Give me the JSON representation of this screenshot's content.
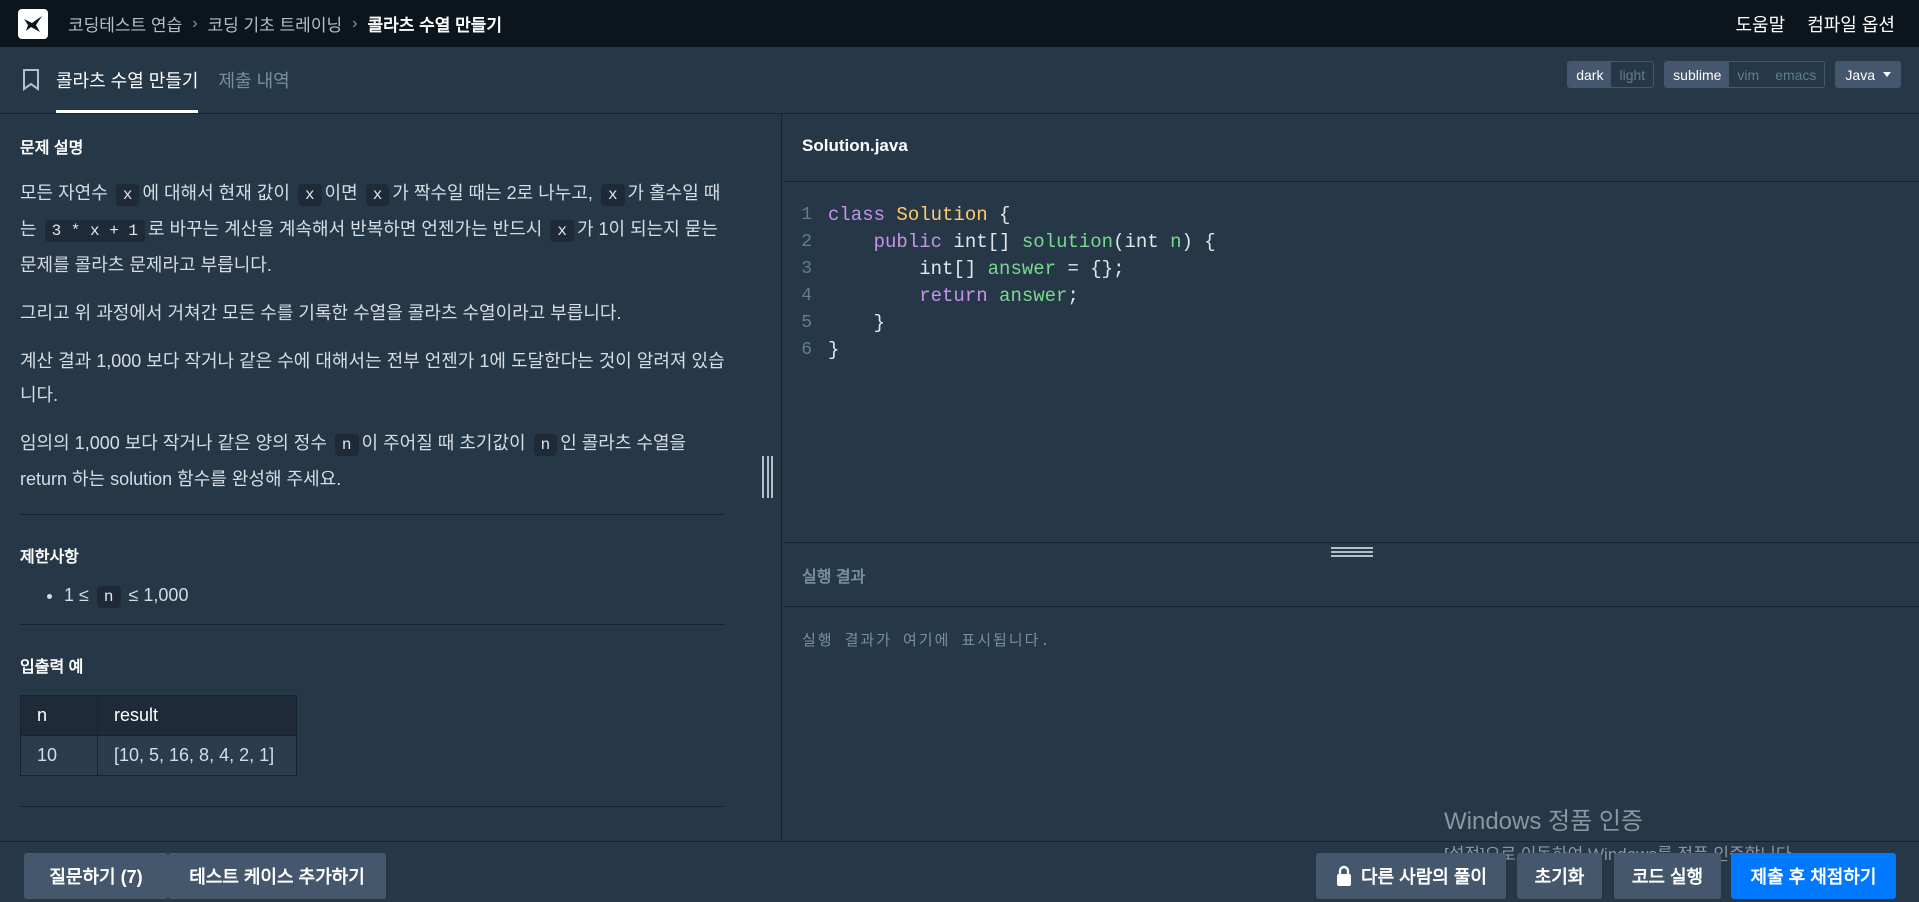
{
  "nav": {
    "breadcrumb": [
      "코딩테스트 연습",
      "코딩 기초 트레이닝",
      "콜라츠 수열 만들기"
    ],
    "help": "도움말",
    "compile_options": "컴파일 옵션"
  },
  "tabs": {
    "problem": "콜라츠 수열 만들기",
    "submissions": "제출 내역"
  },
  "editor_options": {
    "theme": [
      "dark",
      "light"
    ],
    "keymap": [
      "sublime",
      "vim",
      "emacs"
    ],
    "language": "Java"
  },
  "problem": {
    "section_description": "문제 설명",
    "p1_a": "모든 자연수",
    "p1_x1": "x",
    "p1_b": "에 대해서 현재 값이",
    "p1_x2": "x",
    "p1_c": "이면",
    "p1_x3": "x",
    "p1_d": "가 짝수일 때는 2로 나누고,",
    "p1_x4": "x",
    "p1_e": "가 홀수일 때는",
    "p1_expr": "3 * x + 1",
    "p1_f": "로 바꾸는 계산을 계속해서 반복하면 언젠가는 반드시",
    "p1_x5": "x",
    "p1_g": "가 1이 되는지 묻는 문제를 콜라츠 문제라고 부릅니다.",
    "p2": "그리고 위 과정에서 거쳐간 모든 수를 기록한 수열을 콜라츠 수열이라고 부릅니다.",
    "p3": "계산 결과 1,000 보다 작거나 같은 수에 대해서는 전부 언젠가 1에 도달한다는 것이 알려져 있습니다.",
    "p4_a": "임의의 1,000 보다 작거나 같은 양의 정수",
    "p4_n1": "n",
    "p4_b": "이 주어질 때 초기값이",
    "p4_n2": "n",
    "p4_c": "인 콜라츠 수열을 return 하는 solution 함수를 완성해 주세요.",
    "section_constraints": "제한사항",
    "constraint_a": "1 ≤",
    "constraint_n": "n",
    "constraint_b": "≤ 1,000",
    "section_examples": "입출력 예",
    "table_headers": [
      "n",
      "result"
    ],
    "table_rows": [
      [
        "10",
        "[10, 5, 16, 8, 4, 2, 1]"
      ]
    ]
  },
  "editor": {
    "filename": "Solution.java",
    "line_numbers": [
      "1",
      "2",
      "3",
      "4",
      "5",
      "6"
    ],
    "code": {
      "l1_kw": "class",
      "l1_cls": "Solution",
      "l1_rest": " {",
      "l2_kw": "public",
      "l2_type": " int[] ",
      "l2_fn": "solution",
      "l2_p1": "(int ",
      "l2_var": "n",
      "l2_p2": ") {",
      "l3_type": "int[] ",
      "l3_var": "answer",
      "l3_rest": " = {};",
      "l4_kw": "return",
      "l4_var": "answer",
      "l4_rest": ";",
      "l5": "}",
      "l6": "}"
    }
  },
  "result": {
    "title": "실행 결과",
    "placeholder": "실행 결과가 여기에 표시됩니다."
  },
  "watermark": {
    "line1": "Windows 정품 인증",
    "line2": "[설정]으로 이동하여 Windows를 정품 인증합니다."
  },
  "buttons": {
    "ask": "질문하기 (7)",
    "add_testcase": "테스트 케이스 추가하기",
    "others_solution": "다른 사람의 풀이",
    "reset": "초기화",
    "run": "코드 실행",
    "submit": "제출 후 채점하기"
  },
  "colors": {
    "background": "#263747",
    "topnav": "#0c151c",
    "primary_button": "#0078ff",
    "secondary_button": "#44576c"
  }
}
